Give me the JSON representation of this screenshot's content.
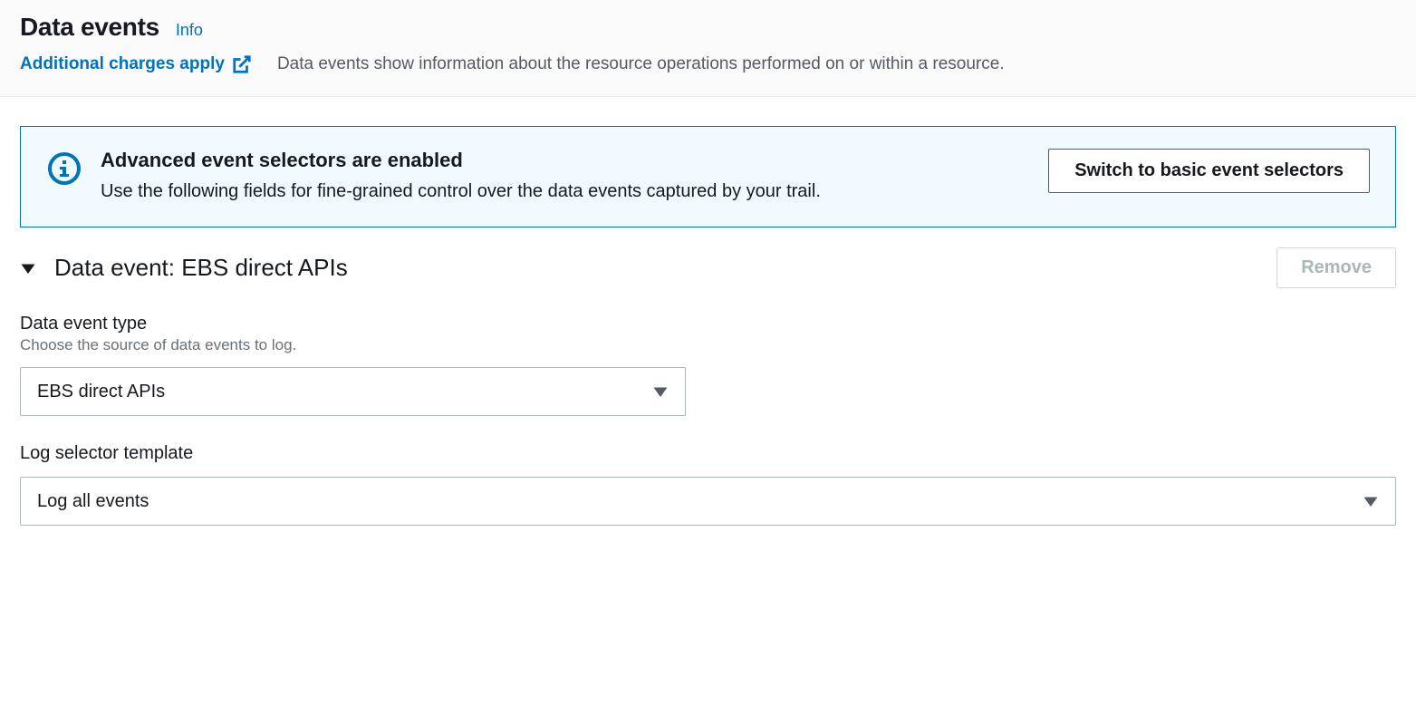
{
  "header": {
    "title": "Data events",
    "info_link": "Info",
    "charges_link": "Additional charges apply",
    "description": "Data events show information about the resource operations performed on or within a resource."
  },
  "banner": {
    "title": "Advanced event selectors are enabled",
    "description": "Use the following fields for fine-grained control over the data events captured by your trail.",
    "switch_button": "Switch to basic event selectors"
  },
  "section": {
    "title": "Data event: EBS direct APIs",
    "remove_button": "Remove"
  },
  "fields": {
    "data_event_type": {
      "label": "Data event type",
      "help": "Choose the source of data events to log.",
      "value": "EBS direct APIs"
    },
    "log_selector_template": {
      "label": "Log selector template",
      "value": "Log all events"
    }
  }
}
